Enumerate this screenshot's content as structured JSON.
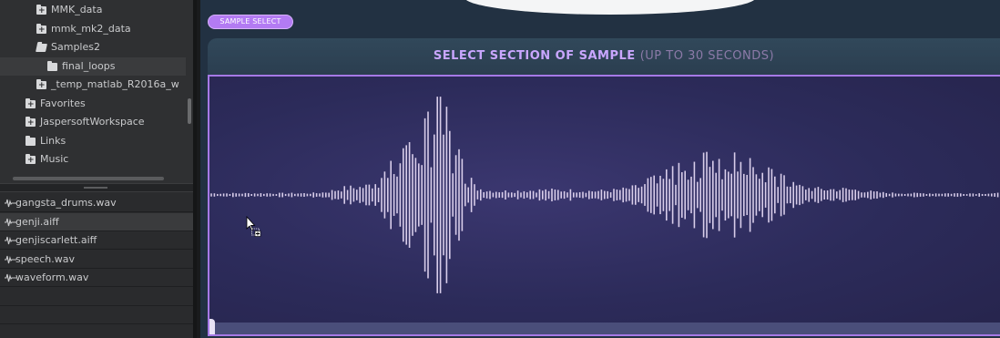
{
  "browser": {
    "folders": [
      {
        "label": "MMK_data",
        "icon": "folder-plus-icon",
        "selected": false
      },
      {
        "label": "mmk_mk2_data",
        "icon": "folder-plus-icon",
        "selected": false
      },
      {
        "label": "Samples2",
        "icon": "folder-open-icon",
        "selected": false
      },
      {
        "label": "final_loops",
        "icon": "folder-icon",
        "selected": true
      },
      {
        "label": "_temp_matlab_R2016a_w",
        "icon": "folder-plus-icon",
        "selected": false
      },
      {
        "label": "Favorites",
        "icon": "folder-plus-icon",
        "selected": false
      },
      {
        "label": "JaspersoftWorkspace",
        "icon": "folder-plus-icon",
        "selected": false
      },
      {
        "label": "Links",
        "icon": "folder-icon",
        "selected": false
      },
      {
        "label": "Music",
        "icon": "folder-plus-icon",
        "selected": false
      }
    ],
    "files": [
      {
        "label": "gangsta_drums.wav",
        "icon": "audio-wave-icon",
        "selected": false
      },
      {
        "label": "genji.aiff",
        "icon": "audio-wave-icon",
        "selected": true
      },
      {
        "label": "genjiscarlett.aiff",
        "icon": "audio-wave-icon",
        "selected": false
      },
      {
        "label": "speech.wav",
        "icon": "audio-wave-icon",
        "selected": false
      },
      {
        "label": "waveform.wav",
        "icon": "audio-wave-icon",
        "selected": false
      }
    ]
  },
  "sample_panel": {
    "tab_label": "SAMPLE SELECT",
    "title_main": "SELECT SECTION OF SAMPLE",
    "title_sub": "(UP TO 30 SECONDS)"
  },
  "colors": {
    "accent": "#b37bf3",
    "waveform": "#d8cdea"
  }
}
